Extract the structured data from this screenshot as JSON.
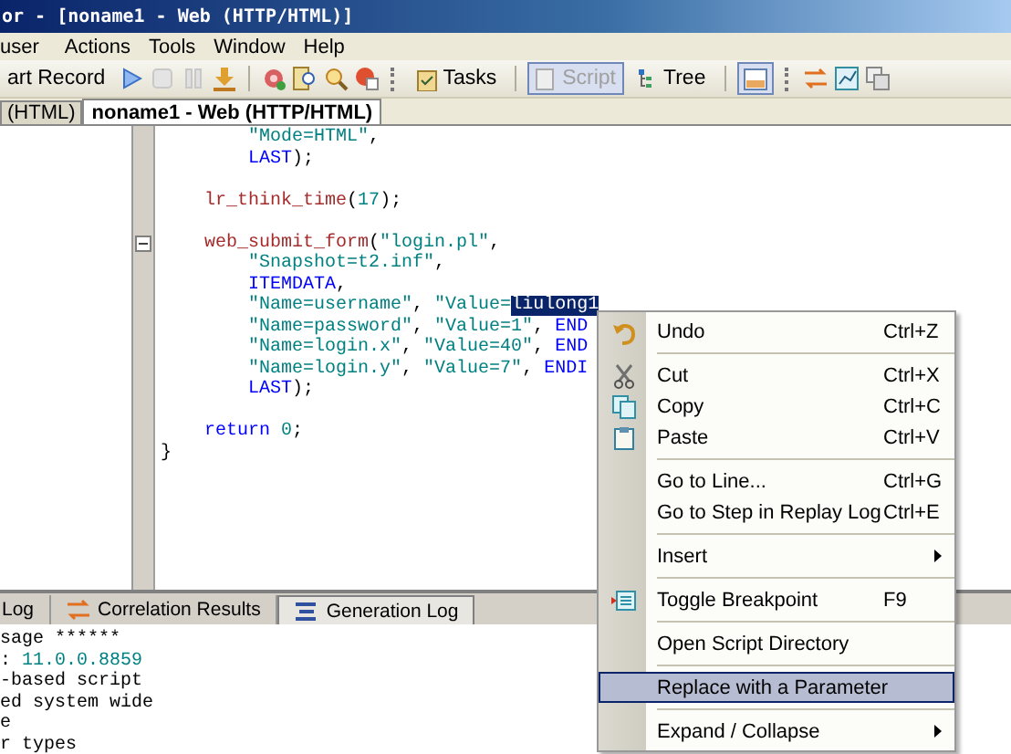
{
  "window": {
    "title": "or - [noname1 - Web (HTTP/HTML)]"
  },
  "menu_bar": [
    "user",
    "Actions",
    "Tools",
    "Window",
    "Help"
  ],
  "toolbar": [
    {
      "label": "art Record",
      "selected": false,
      "disabled": false
    },
    {
      "label": "Tasks",
      "selected": false,
      "disabled": false
    },
    {
      "label": "Script",
      "selected": true,
      "disabled": true
    },
    {
      "label": "Tree",
      "selected": false,
      "disabled": false
    }
  ],
  "document_tabs": [
    {
      "label": "(HTML)",
      "selected": false
    },
    {
      "label": "noname1 - Web (HTTP/HTML)",
      "selected": true
    }
  ],
  "code": [
    {
      "gap_before": false,
      "fold": false,
      "segments": [
        {
          "kind": "str",
          "text": "        \"Mode=HTML\""
        },
        {
          "kind": "plain",
          "text": ","
        }
      ]
    },
    {
      "gap_before": false,
      "fold": false,
      "segments": [
        {
          "kind": "kw",
          "text": "        LAST"
        },
        {
          "kind": "plain",
          "text": ");"
        }
      ]
    },
    {
      "gap_before": true,
      "fold": false,
      "segments": [
        {
          "kind": "fn",
          "text": "    lr_think_time"
        },
        {
          "kind": "plain",
          "text": "("
        },
        {
          "kind": "num",
          "text": "17"
        },
        {
          "kind": "plain",
          "text": ");"
        }
      ]
    },
    {
      "gap_before": true,
      "fold": true,
      "segments": [
        {
          "kind": "fn",
          "text": "    web_submit_form"
        },
        {
          "kind": "plain",
          "text": "("
        },
        {
          "kind": "str",
          "text": "\"login.pl\""
        },
        {
          "kind": "plain",
          "text": ","
        }
      ]
    },
    {
      "gap_before": false,
      "fold": false,
      "segments": [
        {
          "kind": "str",
          "text": "        \"Snapshot=t2.inf\""
        },
        {
          "kind": "plain",
          "text": ","
        }
      ]
    },
    {
      "gap_before": false,
      "fold": false,
      "segments": [
        {
          "kind": "kw",
          "text": "        ITEMDATA"
        },
        {
          "kind": "plain",
          "text": ","
        }
      ]
    },
    {
      "gap_before": false,
      "fold": false,
      "segments": [
        {
          "kind": "str",
          "text": "        \"Name=username\""
        },
        {
          "kind": "plain",
          "text": ", "
        },
        {
          "kind": "str",
          "text": "\"Value="
        },
        {
          "kind": "sel",
          "text": "liulong1"
        }
      ]
    },
    {
      "gap_before": false,
      "fold": false,
      "segments": [
        {
          "kind": "str",
          "text": "        \"Name=password\""
        },
        {
          "kind": "plain",
          "text": ", "
        },
        {
          "kind": "str",
          "text": "\"Value=1\""
        },
        {
          "kind": "plain",
          "text": ", "
        },
        {
          "kind": "kw",
          "text": "END"
        }
      ]
    },
    {
      "gap_before": false,
      "fold": false,
      "segments": [
        {
          "kind": "str",
          "text": "        \"Name=login.x\""
        },
        {
          "kind": "plain",
          "text": ", "
        },
        {
          "kind": "str",
          "text": "\"Value=40\""
        },
        {
          "kind": "plain",
          "text": ", "
        },
        {
          "kind": "kw",
          "text": "END"
        }
      ]
    },
    {
      "gap_before": false,
      "fold": false,
      "segments": [
        {
          "kind": "str",
          "text": "        \"Name=login.y\""
        },
        {
          "kind": "plain",
          "text": ", "
        },
        {
          "kind": "str",
          "text": "\"Value=7\""
        },
        {
          "kind": "plain",
          "text": ", "
        },
        {
          "kind": "kw",
          "text": "ENDI"
        }
      ]
    },
    {
      "gap_before": false,
      "fold": false,
      "segments": [
        {
          "kind": "kw",
          "text": "        LAST"
        },
        {
          "kind": "plain",
          "text": ");"
        }
      ]
    },
    {
      "gap_before": true,
      "fold": false,
      "segments": [
        {
          "kind": "kw",
          "text": "    return"
        },
        {
          "kind": "num",
          "text": " 0"
        },
        {
          "kind": "plain",
          "text": ";"
        }
      ]
    },
    {
      "gap_before": false,
      "fold": false,
      "segments": [
        {
          "kind": "plain",
          "text": "}"
        }
      ]
    }
  ],
  "context_menu": [
    {
      "kind": "item",
      "label": "Undo",
      "shortcut": "Ctrl+Z",
      "selected": false,
      "submenu": false
    },
    {
      "kind": "separator"
    },
    {
      "kind": "item",
      "label": "Cut",
      "shortcut": "Ctrl+X",
      "selected": false,
      "submenu": false
    },
    {
      "kind": "item",
      "label": "Copy",
      "shortcut": "Ctrl+C",
      "selected": false,
      "submenu": false
    },
    {
      "kind": "item",
      "label": "Paste",
      "shortcut": "Ctrl+V",
      "selected": false,
      "submenu": false
    },
    {
      "kind": "separator"
    },
    {
      "kind": "item",
      "label": "Go to Line...",
      "shortcut": "Ctrl+G",
      "selected": false,
      "submenu": false
    },
    {
      "kind": "item",
      "label": "Go to Step in Replay Log",
      "shortcut": "Ctrl+E",
      "selected": false,
      "submenu": false
    },
    {
      "kind": "separator"
    },
    {
      "kind": "item",
      "label": "Insert",
      "selected": false,
      "submenu": true
    },
    {
      "kind": "separator"
    },
    {
      "kind": "item",
      "label": "Toggle Breakpoint",
      "shortcut": "F9",
      "selected": false,
      "submenu": false
    },
    {
      "kind": "separator"
    },
    {
      "kind": "item",
      "label": "Open Script Directory",
      "selected": false,
      "submenu": false
    },
    {
      "kind": "separator"
    },
    {
      "kind": "item",
      "label": "Replace with a Parameter",
      "selected": true,
      "submenu": false
    },
    {
      "kind": "separator"
    },
    {
      "kind": "item",
      "label": "Expand / Collapse",
      "selected": false,
      "submenu": true
    }
  ],
  "output_tabs": [
    {
      "label": "Log",
      "selected": false
    },
    {
      "label": "Correlation Results",
      "selected": false
    },
    {
      "label": "Generation Log",
      "selected": true
    }
  ],
  "log_lines": [
    [
      {
        "kind": "plain",
        "text": "sage ******"
      }
    ],
    [
      {
        "kind": "plain",
        "text": ": "
      },
      {
        "kind": "num",
        "text": "11.0.0.8859"
      }
    ],
    [
      {
        "kind": "plain",
        "text": "-based script"
      }
    ],
    [
      {
        "kind": "plain",
        "text": "ed system wide"
      }
    ],
    [
      {
        "kind": "plain",
        "text": "e"
      }
    ],
    [
      {
        "kind": "plain",
        "text": "r types"
      }
    ]
  ]
}
